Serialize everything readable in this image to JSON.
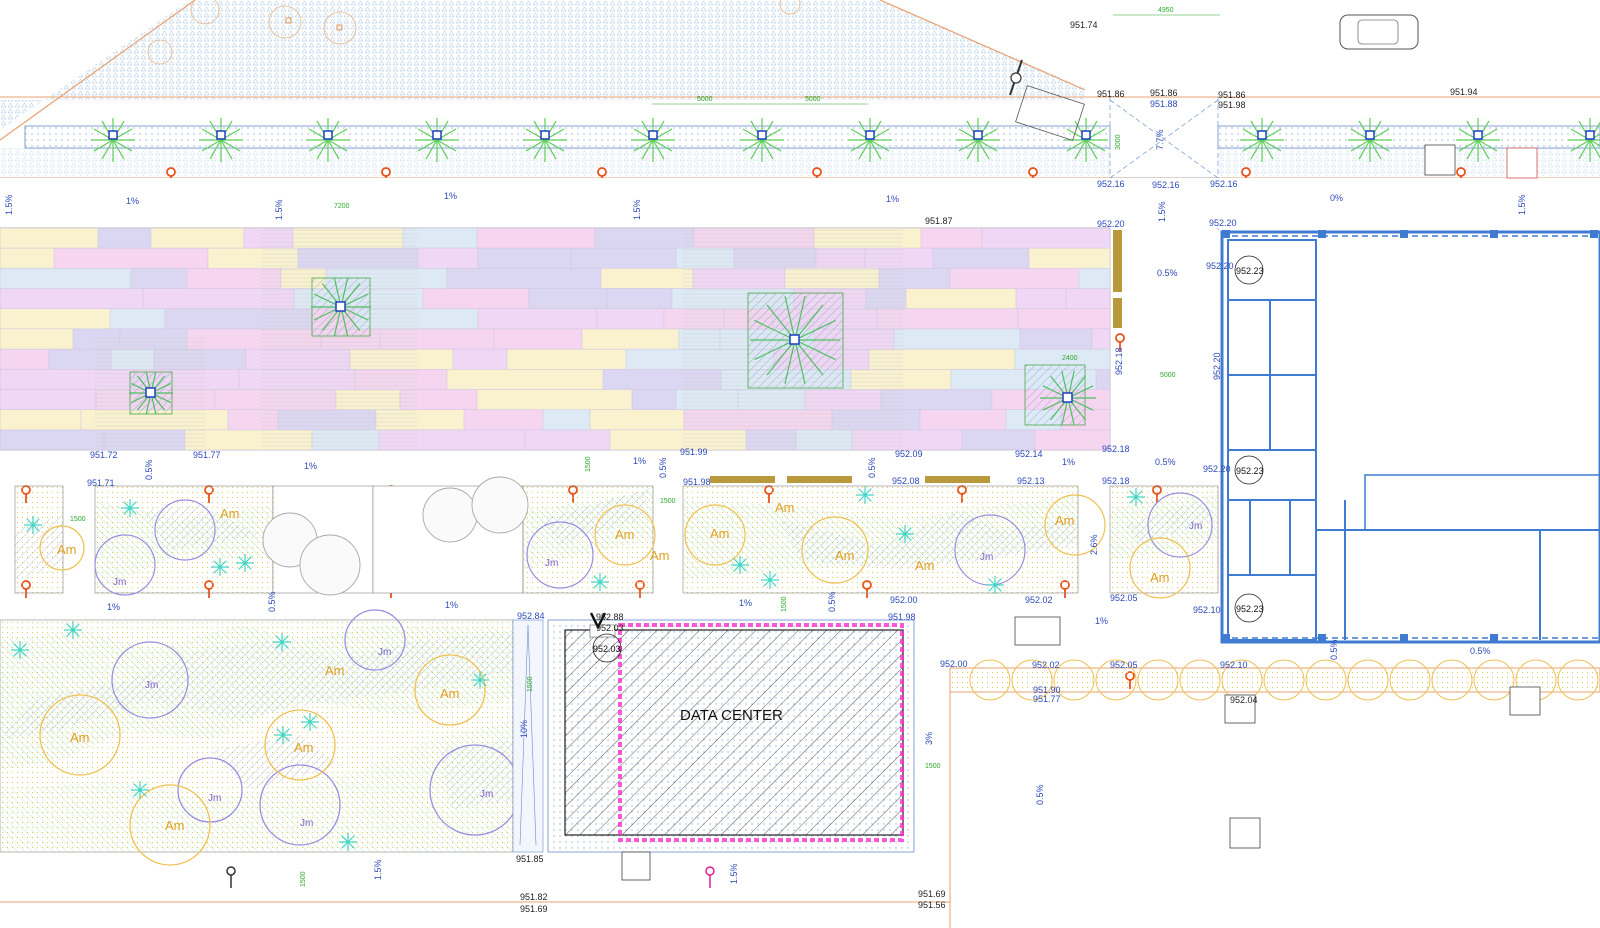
{
  "drawing": {
    "building_label": "DATA CENTER",
    "colors": {
      "building_wall": "#3f7bd0",
      "pavement_blue": "#9ec3e6",
      "planting_green": "#79d27a",
      "planting_yellow": "#f5dc8a",
      "paving_pink": "#e8b8e6",
      "paving_lilac": "#c8c0ec",
      "lamp_orange": "#e8521c",
      "lamp_magenta": "#e0209a",
      "hatch_grey": "#333333",
      "dashed_magenta": "#ff30d0"
    },
    "levels": {
      "l951_74": "951.74",
      "l951_86a": "951.86",
      "l951_86b": "951.86",
      "l951_88": "951.88",
      "l951_86c": "951.86",
      "l951_98top": "951.98",
      "l951_94": "951.94",
      "l952_16a": "952.16",
      "l952_16b": "952.16",
      "l952_16c": "952.16",
      "l951_87": "951.87",
      "l952_20a": "952.20",
      "l952_20b": "952.20",
      "l952_20c": "952.20",
      "l952_23a": "952.23",
      "l952_18a": "952.18",
      "l952_20v": "952.20",
      "l951_72": "951.72",
      "l951_77": "951.77",
      "l951_99": "951.99",
      "l952_09": "952.09",
      "l952_14": "952.14",
      "l952_18b": "952.18",
      "l951_71": "951.71",
      "l951_98mid": "951.98",
      "l952_08": "952.08",
      "l952_13": "952.13",
      "l952_18c": "952.18",
      "l952_20d": "952.20",
      "l952_23b": "952.23",
      "l952_00a": "952.00",
      "l952_02a": "952.02",
      "l952_05a": "952.05",
      "l952_10a": "952.10",
      "l952_23c": "952.23",
      "l952_84": "952.84",
      "l952_88": "952.88",
      "l952_03a": "952.03",
      "l952_03b": "952.03",
      "l951_98low": "951.98",
      "l952_00b": "952.00",
      "l952_02b": "952.02",
      "l952_05b": "952.05",
      "l952_10b": "952.10",
      "l951_90": "951.90",
      "l951_77b": "951.77",
      "l952_04": "952.04",
      "l951_85": "951.85",
      "l951_82": "951.82",
      "l951_69a": "951.69",
      "l951_69b": "951.69",
      "l951_56": "951.56"
    },
    "slopes": {
      "s1": "1.5%",
      "s2": "1%",
      "s3": "1.5%",
      "s4": "1%",
      "s5": "1.5%",
      "s6": "1%",
      "s7": "7.7%",
      "s8": "1.5%",
      "s9": "0%",
      "s10": "1.5%",
      "s11": "0.5%",
      "s12": "0.5%",
      "s13": "1%",
      "s14": "1%",
      "s15": "0.5%",
      "s16": "0.5%",
      "s17": "1%",
      "s18": "0.5%",
      "s19": "1%",
      "s20": "0.5%",
      "s21": "1%",
      "s22": "0.5%",
      "s23": "1%",
      "s24": "2.6%",
      "s25": "1%",
      "s26": "0.5%",
      "s27": "0.5%",
      "s28": "10%",
      "s29": "3%",
      "s30": "0.5%",
      "s31": "1.5%",
      "s32": "1.5%"
    },
    "dimensions": {
      "d1": "5000",
      "d2": "5000",
      "d3": "4950",
      "d4": "7200",
      "d5": "3000",
      "d6": "5000",
      "d7": "2400",
      "d8": "1500",
      "d9": "1500",
      "d10": "1500",
      "d11": "1500",
      "d12": "1500",
      "d13": "1500",
      "d14": "1500"
    },
    "plant_codes": {
      "am": "Am",
      "jm": "Jm"
    }
  }
}
